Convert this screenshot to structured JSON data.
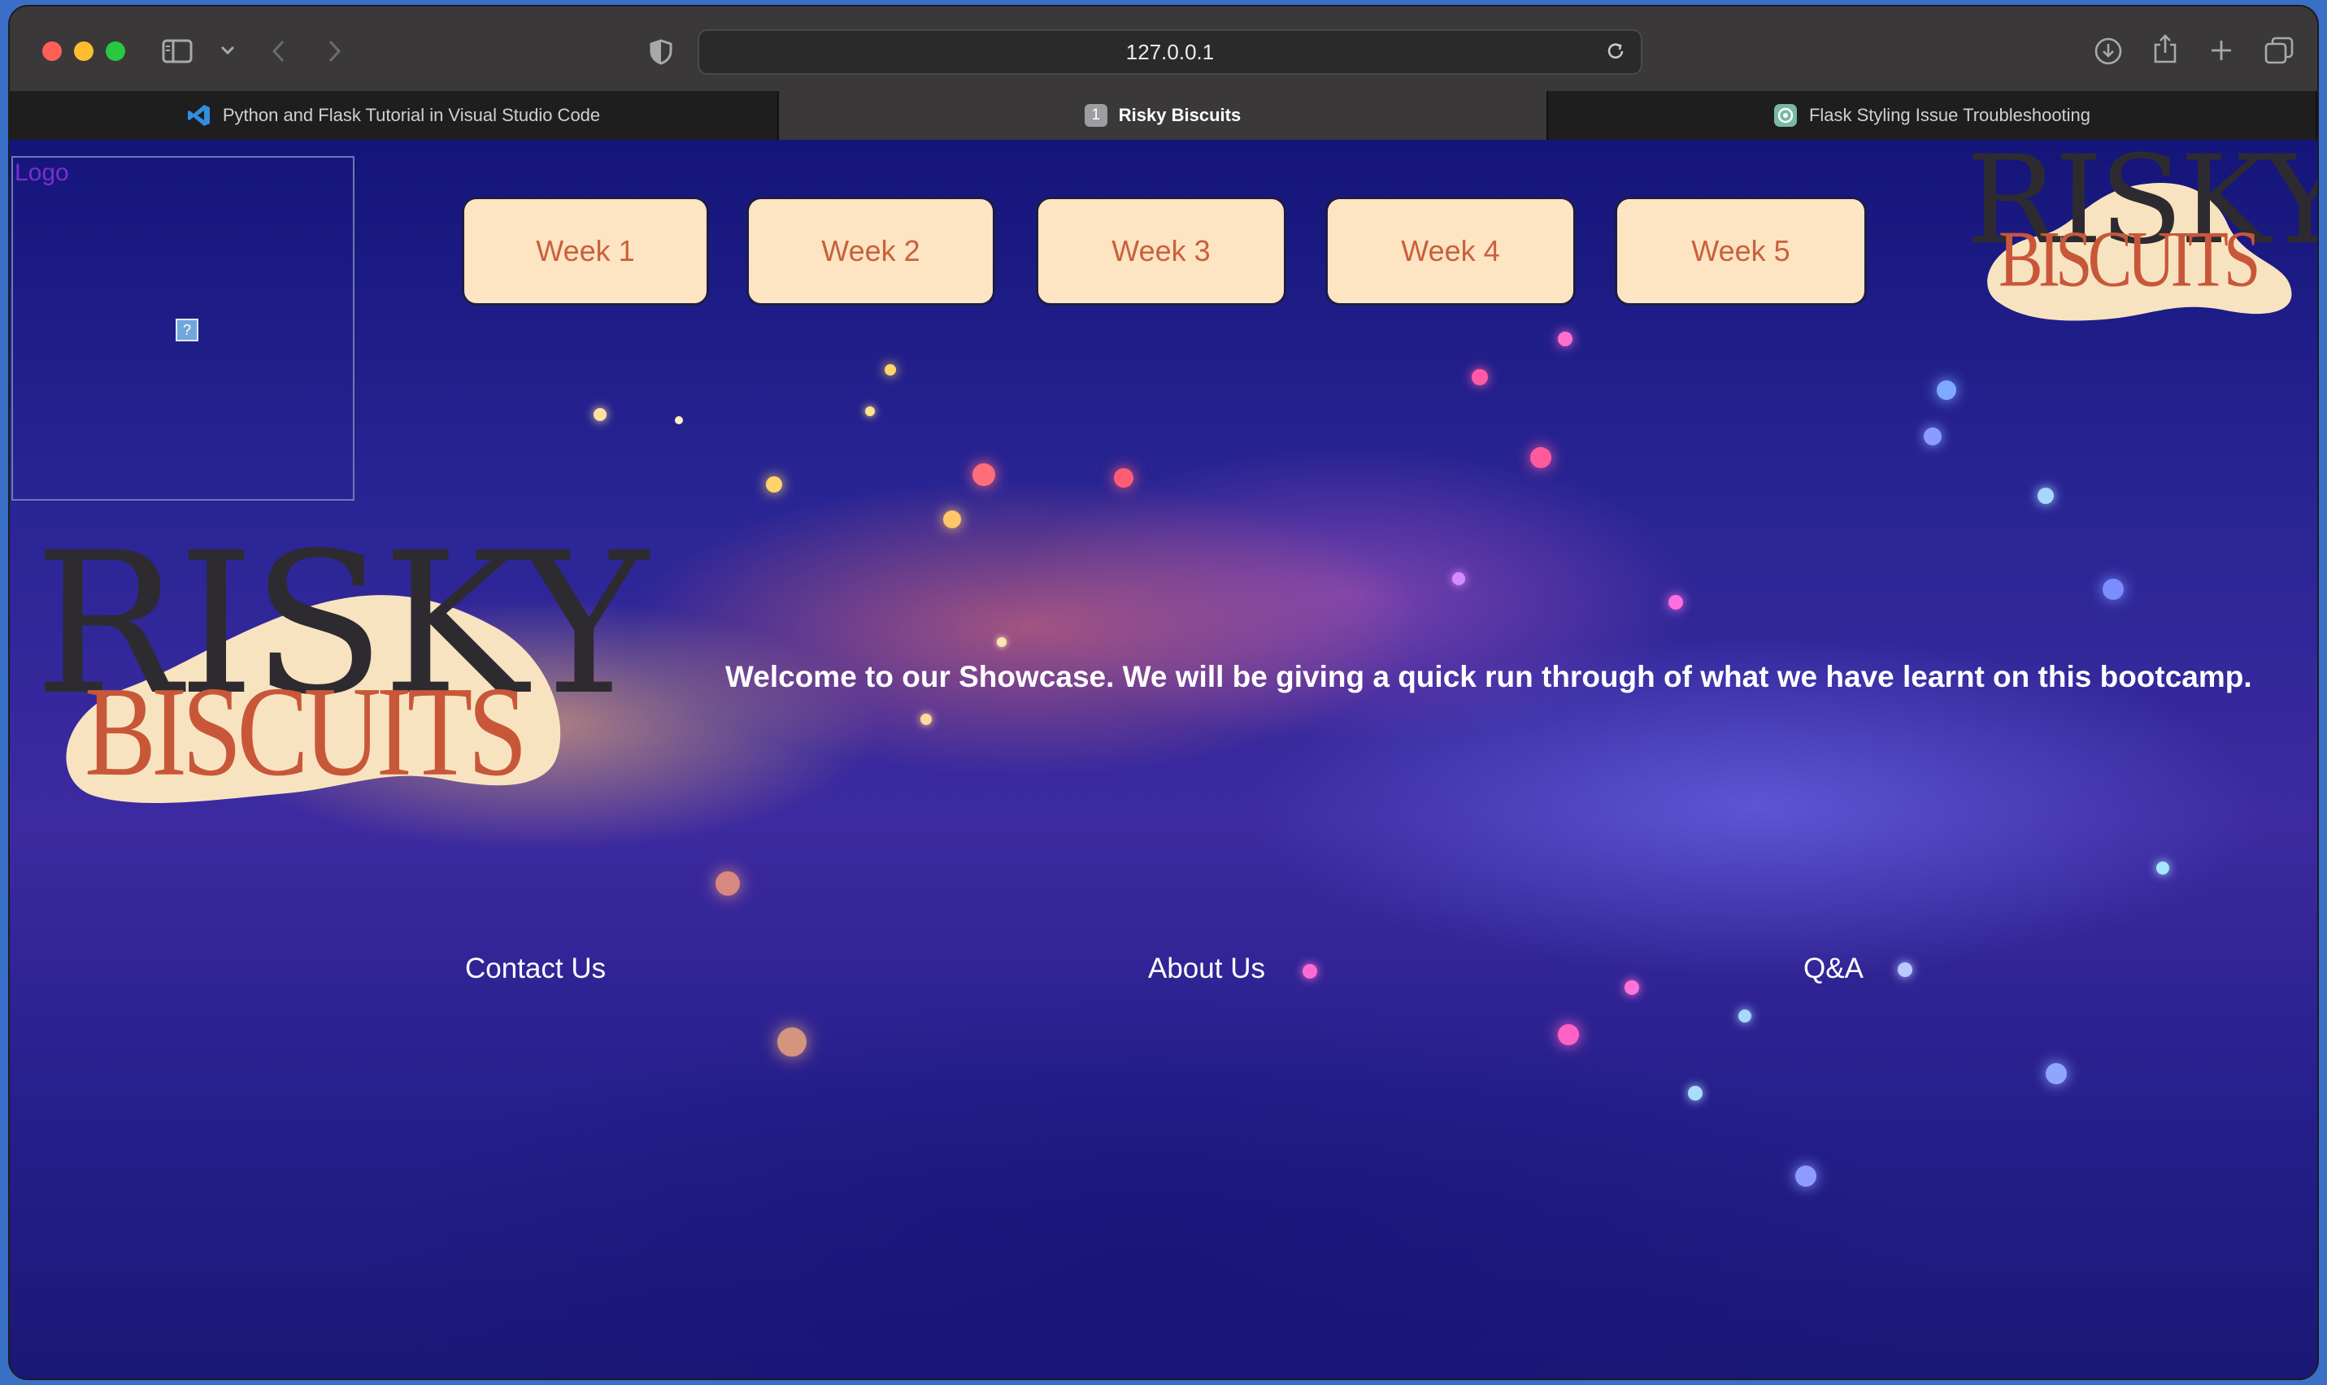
{
  "browser": {
    "address": "127.0.0.1",
    "tabs": [
      {
        "title": "Python and Flask Tutorial in Visual Studio Code",
        "icon": "vscode-icon",
        "active": false
      },
      {
        "title": "Risky Biscuits",
        "icon": "tab-number-icon",
        "badge": "1",
        "active": true
      },
      {
        "title": "Flask Styling Issue Troubleshooting",
        "icon": "chatgpt-icon",
        "active": false
      }
    ]
  },
  "page": {
    "logo_alt": "Logo",
    "broken_image_glyph": "?",
    "nav": [
      "Week 1",
      "Week 2",
      "Week 3",
      "Week 4",
      "Week 5"
    ],
    "brand": {
      "top": "RISKY",
      "bottom": "BISCUITS"
    },
    "welcome": "Welcome to our Showcase. We will be giving a quick run through of what we have learnt on this bootcamp.",
    "footer": [
      "Contact Us",
      "About Us",
      "Q&A"
    ],
    "colors": {
      "button_bg": "#fde4c2",
      "button_text": "#c9613d",
      "brand_dark": "#2e2b30",
      "brand_accent": "#c8573a",
      "brand_blob": "#f8e3c0"
    }
  }
}
